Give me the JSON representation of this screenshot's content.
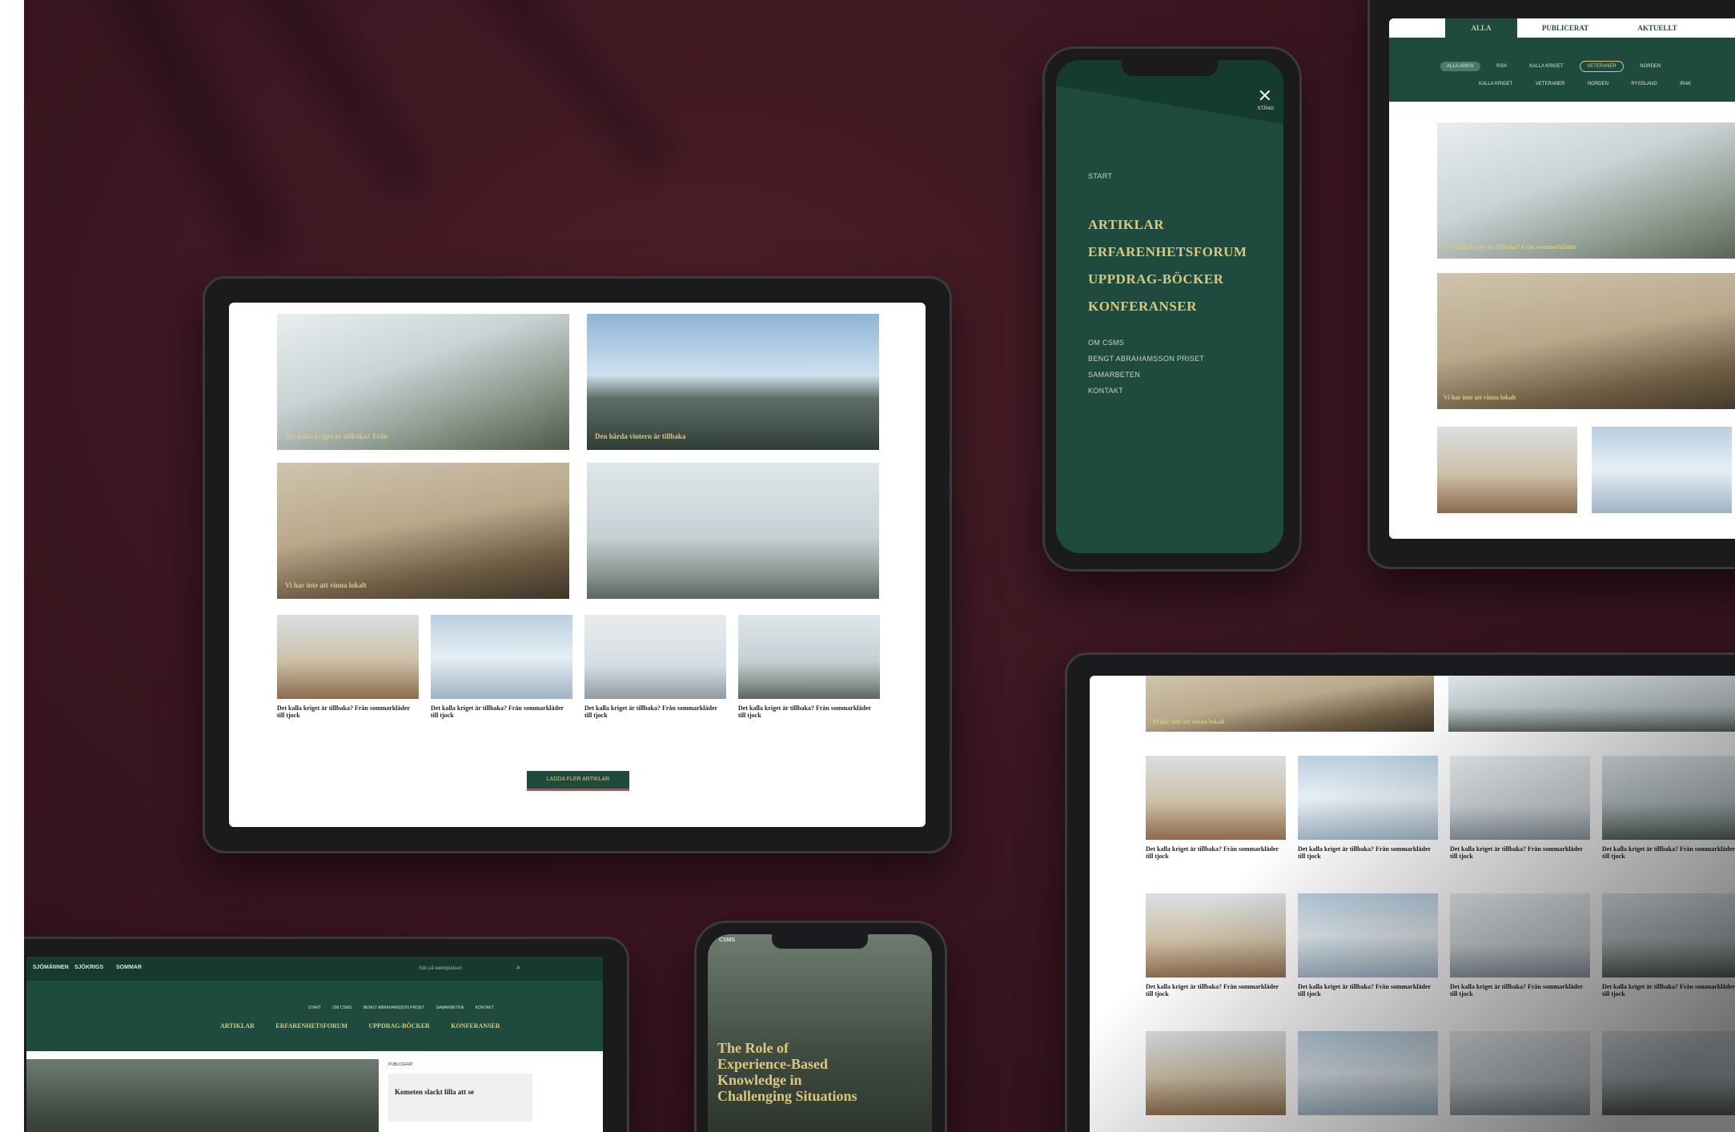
{
  "colors": {
    "background": "#3b1620",
    "brand_green": "#1f4a3e",
    "gold": "#d9c97a"
  },
  "tablet_main": {
    "features": [
      {
        "caption": "Det kalla kriget är tillbaka? Från"
      },
      {
        "caption": "Den hårda vintern är tillbaka"
      },
      {
        "caption": "Vi har inte att vinna lokalt"
      },
      {
        "caption": ""
      }
    ],
    "cards": [
      {
        "title": "Det kalla kriget är tillbaka? Från sommarkläder till tjock"
      },
      {
        "title": "Det kalla kriget är tillbaka? Från sommarkläder till tjock"
      },
      {
        "title": "Det kalla kriget är tillbaka? Från sommarkläder till tjock"
      },
      {
        "title": "Det kalla kriget är tillbaka? Från sommarkläder till tjock"
      }
    ],
    "load_more": "LADDA FLER ARTIKLAR"
  },
  "phone_menu": {
    "close_label": "STÄNG",
    "start": "START",
    "primary": [
      "ARTIKLAR",
      "ERFARENHETSFORUM",
      "UPPDRAG-BÖCKER",
      "KONFERANSER"
    ],
    "secondary": [
      "OM CSMS",
      "BENGT ABRAHAMSSON PRISET",
      "SAMARBETEN",
      "KONTAKT"
    ]
  },
  "tablet_topright": {
    "tabs": [
      "ALLA",
      "PUBLICERAT",
      "AKTUELLT"
    ],
    "filters": [
      "ALLA ARKIV",
      "RSH",
      "KALLA KRIGET",
      "VETERANER",
      "NORDEN"
    ],
    "filters2": [
      "KALLA KRIGET",
      "VETERANER",
      "NORDEN",
      "RYSSLAND",
      "IRAK"
    ],
    "caption1": "Det kalla kriget är tillbaka? Från sommarkläder",
    "caption2": "Vi har inte att vinna lokalt"
  },
  "tablet_bottomright": {
    "caption": "Vi har inte att vinna lokalt",
    "card_title": "Det kalla kriget är tillbaka? Från sommarkläder till tjock"
  },
  "tablet_bottomleft": {
    "topbar": [
      "SJÖMÄNNEN",
      "SJÖKRIGS",
      "SOMMAR"
    ],
    "search_placeholder": "Sök på webbplatsen",
    "nav_small": [
      "START",
      "OM CSMS",
      "BENGT ABRAHAMSSON PRISET",
      "SAMARBETEN",
      "KONTAKT"
    ],
    "nav_big": [
      "ARTIKLAR",
      "ERFARENHETSFORUM",
      "UPPDRAG-BÖCKER",
      "KONFERANSER"
    ],
    "side_label": "PUBLICERAT",
    "side_title": "Kometen slackt lilla att se"
  },
  "phone_bottom": {
    "header": "CSMS",
    "title": "The Role of Experience-Based Knowledge in Challenging Situations"
  }
}
